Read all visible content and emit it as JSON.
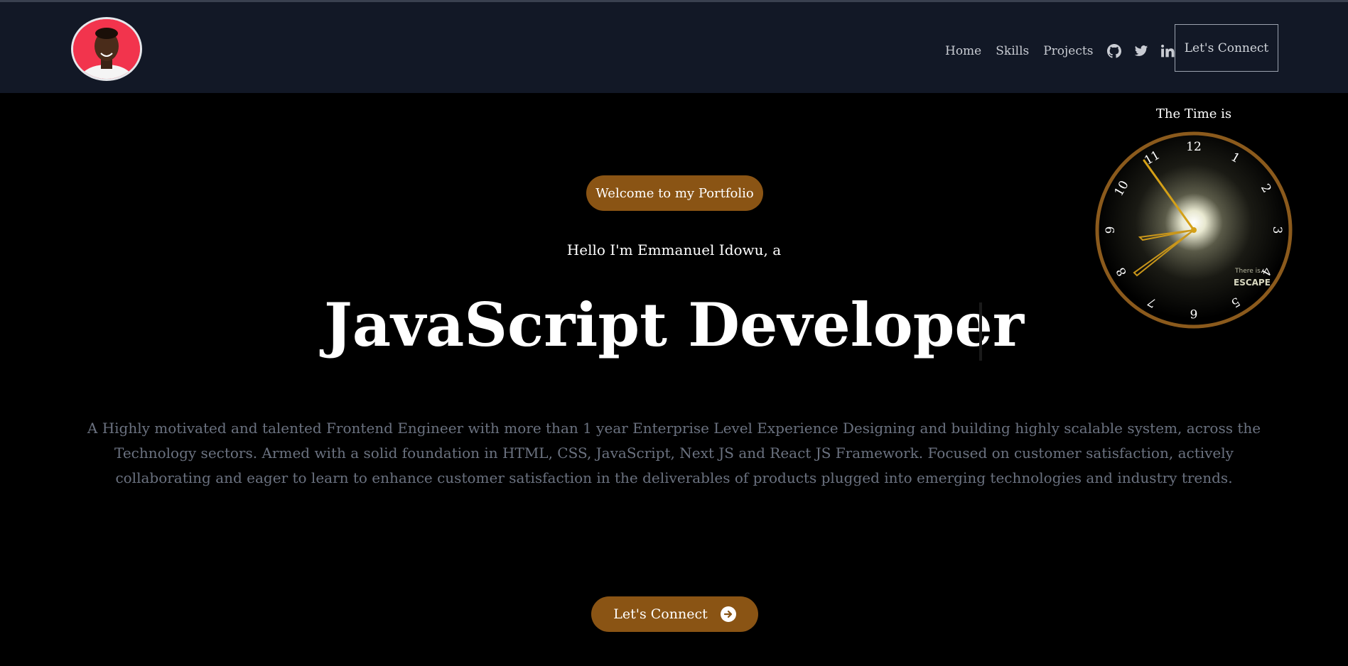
{
  "header": {
    "nav": [
      {
        "label": "Home"
      },
      {
        "label": "Skills"
      },
      {
        "label": "Projects"
      }
    ],
    "icons": [
      "github-icon",
      "twitter-icon",
      "linkedin-icon"
    ],
    "connect_label": "Let's Connect"
  },
  "clock": {
    "title": "The Time is",
    "numbers": [
      "12",
      "1",
      "2",
      "3",
      "4",
      "5",
      "6",
      "7",
      "8",
      "9",
      "10",
      "11"
    ],
    "face_text": [
      "There is...",
      "ESCAPE"
    ]
  },
  "hero": {
    "welcome": "Welcome to my Portfolio",
    "hello": "Hello I'm Emmanuel Idowu, a",
    "title": "JavaScript Developer",
    "description": "A Highly motivated and talented Frontend Engineer with more than 1 year Enterprise Level Experience Designing and building highly scalable system, across the Technology sectors. Armed with a solid foundation in HTML, CSS, JavaScript, Next JS and React JS Framework. Focused on customer satisfaction, actively collaborating and eager to learn to enhance customer satisfaction in the deliverables of products plugged into emerging technologies and industry trends.",
    "cta_label": "Let's Connect"
  },
  "colors": {
    "header_bg": "#121826",
    "accent": "#8a5414",
    "clock_ring": "#8b5a1c",
    "hand": "#d4a017"
  }
}
